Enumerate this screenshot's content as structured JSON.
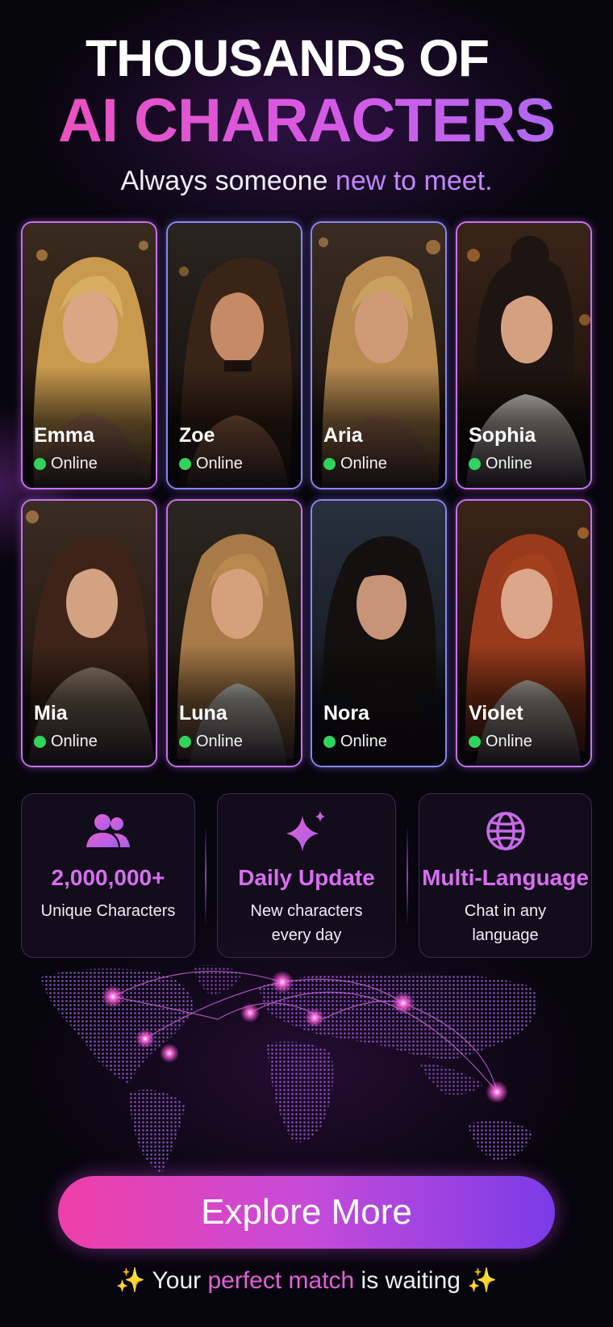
{
  "header": {
    "title_line1": "THOUSANDS OF",
    "title_line2": "AI CHARACTERS",
    "subtitle_plain": "Always someone ",
    "subtitle_highlight": "new to meet."
  },
  "characters": [
    {
      "name": "Emma",
      "status": "Online"
    },
    {
      "name": "Zoe",
      "status": "Online"
    },
    {
      "name": "Aria",
      "status": "Online"
    },
    {
      "name": "Sophia",
      "status": "Online"
    },
    {
      "name": "Mia",
      "status": "Online"
    },
    {
      "name": "Luna",
      "status": "Online"
    },
    {
      "name": "Nora",
      "status": "Online"
    },
    {
      "name": "Violet",
      "status": "Online"
    }
  ],
  "features": [
    {
      "icon": "users-icon",
      "title": "2,000,000+",
      "desc_line1": "Unique Characters",
      "desc_line2": ""
    },
    {
      "icon": "sparkle-icon",
      "title": "Daily Update",
      "desc_line1": "New characters",
      "desc_line2": "every day"
    },
    {
      "icon": "globe-icon",
      "title": "Multi-Language",
      "desc_line1": "Chat in any",
      "desc_line2": "language"
    }
  ],
  "cta": {
    "label": "Explore More"
  },
  "footer": {
    "sparkle_left": "✨",
    "text_before": "Your ",
    "highlight": "perfect match",
    "text_after": " is waiting",
    "sparkle_right": "✨"
  },
  "colors": {
    "background": "#07050d",
    "accent_pink": "#f04fb8",
    "accent_purple": "#a66bf2",
    "online_green": "#30d35c"
  }
}
